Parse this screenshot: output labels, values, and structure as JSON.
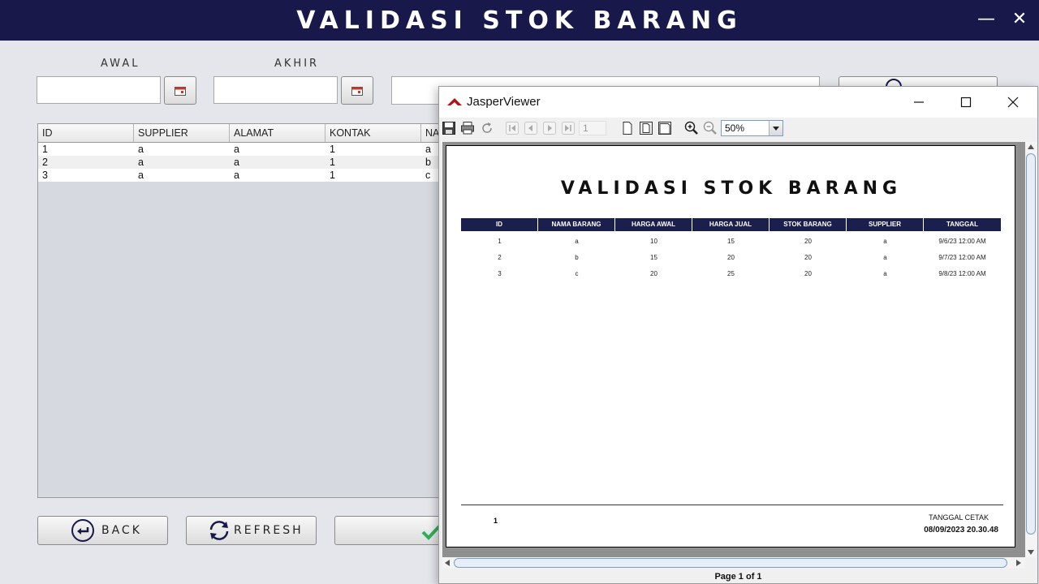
{
  "app": {
    "title": "VALIDASI STOK BARANG",
    "accent_color": "#18194a",
    "window_controls": {
      "minimize": "—",
      "close": "✕"
    }
  },
  "filters": {
    "awal_label": "AWAL",
    "akhir_label": "AKHIR",
    "awal_value": "",
    "akhir_value": "",
    "search_value": ""
  },
  "table": {
    "columns": [
      "ID",
      "SUPPLIER",
      "ALAMAT",
      "KONTAK",
      "NA"
    ],
    "rows": [
      [
        "1",
        "a",
        "a",
        "1",
        "a"
      ],
      [
        "2",
        "a",
        "a",
        "1",
        "b"
      ],
      [
        "3",
        "a",
        "a",
        "1",
        "c"
      ]
    ]
  },
  "buttons": {
    "back": "BACK",
    "refresh": "REFRESH"
  },
  "viewer": {
    "title": "JasperViewer",
    "page_input": "1",
    "zoom": "50%",
    "status": "Page 1 of 1",
    "icons": [
      "save-icon",
      "print-icon",
      "reload-icon",
      "first-page-icon",
      "prev-page-icon",
      "next-page-icon",
      "last-page-icon",
      "actual-size-icon",
      "fit-page-icon",
      "fit-width-icon",
      "zoom-in-icon",
      "zoom-out-icon"
    ]
  },
  "report": {
    "title": "VALIDASI STOK BARANG",
    "header_color": "#1a1f4e",
    "columns": [
      "ID",
      "NAMA BARANG",
      "HARGA AWAL",
      "HARGA JUAL",
      "STOK BARANG",
      "SUPPLIER",
      "TANGGAL"
    ],
    "rows": [
      [
        "1",
        "a",
        "10",
        "15",
        "20",
        "a",
        "9/6/23 12:00 AM"
      ],
      [
        "2",
        "b",
        "15",
        "20",
        "20",
        "a",
        "9/7/23 12:00 AM"
      ],
      [
        "3",
        "c",
        "20",
        "25",
        "20",
        "a",
        "9/8/23 12:00 AM"
      ]
    ],
    "page_number": "1",
    "print_label": "TANGGAL CETAK",
    "print_date": "08/09/2023 20.30.48"
  }
}
